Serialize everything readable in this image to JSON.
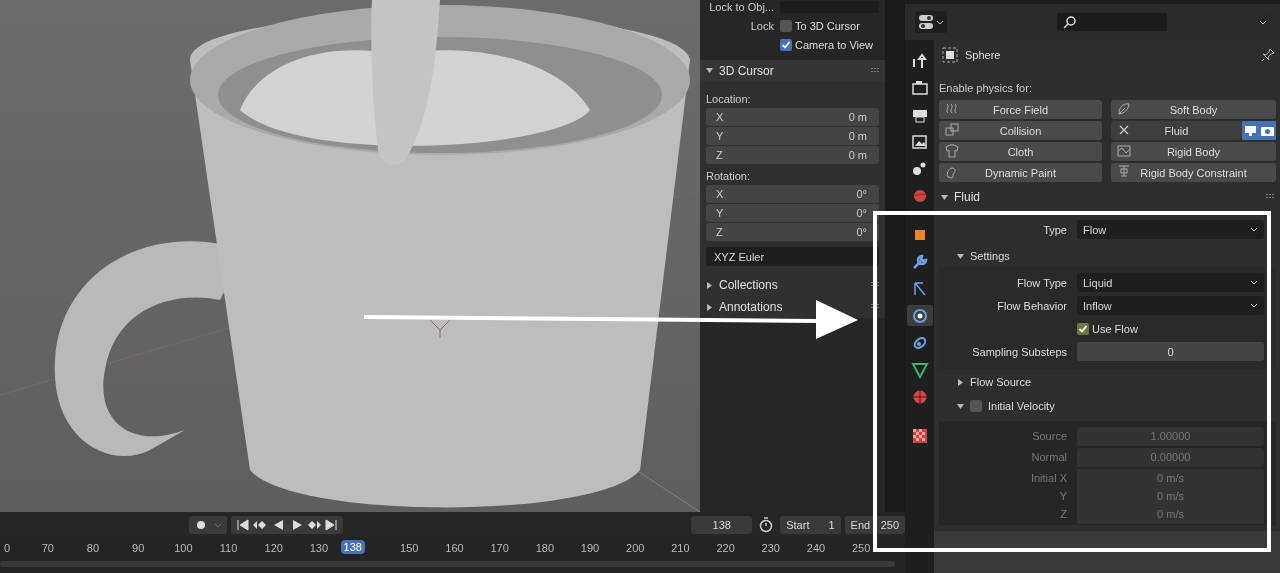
{
  "sidebar": {
    "lock_object_label": "Lock to Obj...",
    "lock_label": "Lock",
    "lock_options": [
      {
        "label": "To 3D Cursor",
        "checked": false
      },
      {
        "label": "Camera to View",
        "checked": true
      }
    ],
    "cursor_panel": {
      "title": "3D Cursor",
      "expanded": true,
      "location_label": "Location:",
      "location": [
        {
          "axis": "X",
          "value": "0 m"
        },
        {
          "axis": "Y",
          "value": "0 m"
        },
        {
          "axis": "Z",
          "value": "0 m"
        }
      ],
      "rotation_label": "Rotation:",
      "rotation": [
        {
          "axis": "X",
          "value": "0°"
        },
        {
          "axis": "Y",
          "value": "0°"
        },
        {
          "axis": "Z",
          "value": "0°"
        }
      ],
      "rotation_mode": "XYZ Euler"
    },
    "collapsed_panels": [
      {
        "title": "Collections",
        "expanded": false
      },
      {
        "title": "Annotations",
        "expanded": false
      }
    ]
  },
  "timeline": {
    "current_frame": "138",
    "start_label": "Start",
    "start": "1",
    "end_label": "End",
    "end": "250",
    "ruler": [
      "0",
      "70",
      "80",
      "90",
      "100",
      "110",
      "120",
      "130",
      "150",
      "160",
      "170",
      "180",
      "190",
      "200",
      "210",
      "220",
      "230",
      "240",
      "250"
    ],
    "playhead": "138"
  },
  "properties": {
    "tabs": [
      {
        "selected": false
      },
      {
        "selected": false
      },
      {
        "selected": false
      },
      {
        "selected": false
      },
      {
        "selected": false
      },
      {
        "selected": false
      },
      {
        "selected": false
      },
      {
        "selected": false
      },
      {
        "selected": false
      },
      {
        "selected": true
      },
      {
        "selected": false
      },
      {
        "selected": false
      },
      {
        "selected": false
      },
      {
        "selected": false
      }
    ],
    "object_name": "Sphere",
    "enable_label": "Enable physics for:",
    "physics_buttons": [
      {
        "label": "Force Field",
        "enabled": false
      },
      {
        "label": "Soft Body",
        "enabled": false
      },
      {
        "label": "Collision",
        "enabled": false
      },
      {
        "label": "Fluid",
        "enabled": true
      },
      {
        "label": "Cloth",
        "enabled": false
      },
      {
        "label": "Rigid Body",
        "enabled": false
      },
      {
        "label": "Dynamic Paint",
        "enabled": false
      },
      {
        "label": "Rigid Body Constraint",
        "enabled": false
      }
    ],
    "fluid_panel": {
      "title": "Fluid",
      "expanded": true,
      "type_label": "Type",
      "type_value": "Flow",
      "settings": {
        "title": "Settings",
        "expanded": true,
        "rows": [
          {
            "kind": "dropdown",
            "label": "Flow Type",
            "value": "Liquid"
          },
          {
            "kind": "dropdown",
            "label": "Flow Behavior",
            "value": "Inflow"
          },
          {
            "kind": "checkbox",
            "label": "Use Flow",
            "checked": true
          },
          {
            "kind": "number",
            "label": "Sampling Substeps",
            "value": "0"
          }
        ]
      },
      "flow_source": {
        "title": "Flow Source",
        "expanded": false
      },
      "initial_velocity": {
        "title": "Initial Velocity",
        "expanded": true,
        "checked": false,
        "rows": [
          {
            "label": "Source",
            "value": "1.00000"
          },
          {
            "label": "Normal",
            "value": "0.00000"
          },
          {
            "label": "Initial X",
            "value": "0 m/s"
          },
          {
            "label": "Y",
            "value": "0 m/s"
          },
          {
            "label": "Z",
            "value": "0 m/s"
          }
        ]
      }
    }
  }
}
